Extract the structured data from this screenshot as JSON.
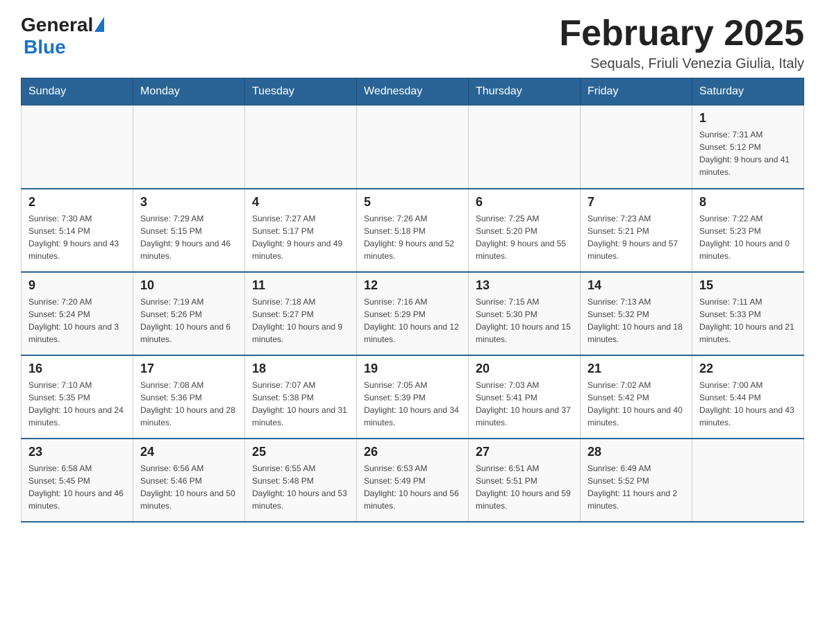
{
  "header": {
    "logo_general": "General",
    "logo_blue": "Blue",
    "title": "February 2025",
    "subtitle": "Sequals, Friuli Venezia Giulia, Italy"
  },
  "weekdays": [
    "Sunday",
    "Monday",
    "Tuesday",
    "Wednesday",
    "Thursday",
    "Friday",
    "Saturday"
  ],
  "weeks": [
    [
      {
        "day": "",
        "info": ""
      },
      {
        "day": "",
        "info": ""
      },
      {
        "day": "",
        "info": ""
      },
      {
        "day": "",
        "info": ""
      },
      {
        "day": "",
        "info": ""
      },
      {
        "day": "",
        "info": ""
      },
      {
        "day": "1",
        "info": "Sunrise: 7:31 AM\nSunset: 5:12 PM\nDaylight: 9 hours and 41 minutes."
      }
    ],
    [
      {
        "day": "2",
        "info": "Sunrise: 7:30 AM\nSunset: 5:14 PM\nDaylight: 9 hours and 43 minutes."
      },
      {
        "day": "3",
        "info": "Sunrise: 7:29 AM\nSunset: 5:15 PM\nDaylight: 9 hours and 46 minutes."
      },
      {
        "day": "4",
        "info": "Sunrise: 7:27 AM\nSunset: 5:17 PM\nDaylight: 9 hours and 49 minutes."
      },
      {
        "day": "5",
        "info": "Sunrise: 7:26 AM\nSunset: 5:18 PM\nDaylight: 9 hours and 52 minutes."
      },
      {
        "day": "6",
        "info": "Sunrise: 7:25 AM\nSunset: 5:20 PM\nDaylight: 9 hours and 55 minutes."
      },
      {
        "day": "7",
        "info": "Sunrise: 7:23 AM\nSunset: 5:21 PM\nDaylight: 9 hours and 57 minutes."
      },
      {
        "day": "8",
        "info": "Sunrise: 7:22 AM\nSunset: 5:23 PM\nDaylight: 10 hours and 0 minutes."
      }
    ],
    [
      {
        "day": "9",
        "info": "Sunrise: 7:20 AM\nSunset: 5:24 PM\nDaylight: 10 hours and 3 minutes."
      },
      {
        "day": "10",
        "info": "Sunrise: 7:19 AM\nSunset: 5:26 PM\nDaylight: 10 hours and 6 minutes."
      },
      {
        "day": "11",
        "info": "Sunrise: 7:18 AM\nSunset: 5:27 PM\nDaylight: 10 hours and 9 minutes."
      },
      {
        "day": "12",
        "info": "Sunrise: 7:16 AM\nSunset: 5:29 PM\nDaylight: 10 hours and 12 minutes."
      },
      {
        "day": "13",
        "info": "Sunrise: 7:15 AM\nSunset: 5:30 PM\nDaylight: 10 hours and 15 minutes."
      },
      {
        "day": "14",
        "info": "Sunrise: 7:13 AM\nSunset: 5:32 PM\nDaylight: 10 hours and 18 minutes."
      },
      {
        "day": "15",
        "info": "Sunrise: 7:11 AM\nSunset: 5:33 PM\nDaylight: 10 hours and 21 minutes."
      }
    ],
    [
      {
        "day": "16",
        "info": "Sunrise: 7:10 AM\nSunset: 5:35 PM\nDaylight: 10 hours and 24 minutes."
      },
      {
        "day": "17",
        "info": "Sunrise: 7:08 AM\nSunset: 5:36 PM\nDaylight: 10 hours and 28 minutes."
      },
      {
        "day": "18",
        "info": "Sunrise: 7:07 AM\nSunset: 5:38 PM\nDaylight: 10 hours and 31 minutes."
      },
      {
        "day": "19",
        "info": "Sunrise: 7:05 AM\nSunset: 5:39 PM\nDaylight: 10 hours and 34 minutes."
      },
      {
        "day": "20",
        "info": "Sunrise: 7:03 AM\nSunset: 5:41 PM\nDaylight: 10 hours and 37 minutes."
      },
      {
        "day": "21",
        "info": "Sunrise: 7:02 AM\nSunset: 5:42 PM\nDaylight: 10 hours and 40 minutes."
      },
      {
        "day": "22",
        "info": "Sunrise: 7:00 AM\nSunset: 5:44 PM\nDaylight: 10 hours and 43 minutes."
      }
    ],
    [
      {
        "day": "23",
        "info": "Sunrise: 6:58 AM\nSunset: 5:45 PM\nDaylight: 10 hours and 46 minutes."
      },
      {
        "day": "24",
        "info": "Sunrise: 6:56 AM\nSunset: 5:46 PM\nDaylight: 10 hours and 50 minutes."
      },
      {
        "day": "25",
        "info": "Sunrise: 6:55 AM\nSunset: 5:48 PM\nDaylight: 10 hours and 53 minutes."
      },
      {
        "day": "26",
        "info": "Sunrise: 6:53 AM\nSunset: 5:49 PM\nDaylight: 10 hours and 56 minutes."
      },
      {
        "day": "27",
        "info": "Sunrise: 6:51 AM\nSunset: 5:51 PM\nDaylight: 10 hours and 59 minutes."
      },
      {
        "day": "28",
        "info": "Sunrise: 6:49 AM\nSunset: 5:52 PM\nDaylight: 11 hours and 2 minutes."
      },
      {
        "day": "",
        "info": ""
      }
    ]
  ]
}
